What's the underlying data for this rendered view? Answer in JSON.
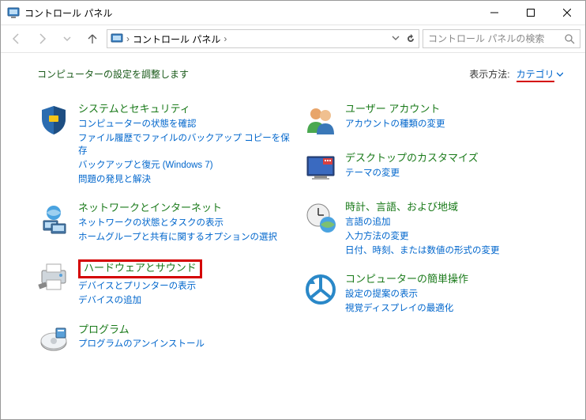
{
  "window": {
    "title": "コントロール パネル"
  },
  "address": {
    "root": "コントロール パネル"
  },
  "search": {
    "placeholder": "コントロール パネルの検索"
  },
  "header": {
    "heading": "コンピューターの設定を調整します",
    "viewLabel": "表示方法:",
    "viewValue": "カテゴリ"
  },
  "left": [
    {
      "title": "システムとセキュリティ",
      "links": [
        "コンピューターの状態を確認",
        "ファイル履歴でファイルのバックアップ コピーを保存",
        "バックアップと復元 (Windows 7)",
        "問題の発見と解決"
      ]
    },
    {
      "title": "ネットワークとインターネット",
      "links": [
        "ネットワークの状態とタスクの表示",
        "ホームグループと共有に関するオプションの選択"
      ]
    },
    {
      "title": "ハードウェアとサウンド",
      "links": [
        "デバイスとプリンターの表示",
        "デバイスの追加"
      ],
      "highlight": true
    },
    {
      "title": "プログラム",
      "links": [
        "プログラムのアンインストール"
      ]
    }
  ],
  "right": [
    {
      "title": "ユーザー アカウント",
      "links": [
        "アカウントの種類の変更"
      ]
    },
    {
      "title": "デスクトップのカスタマイズ",
      "links": [
        "テーマの変更"
      ]
    },
    {
      "title": "時計、言語、および地域",
      "links": [
        "言語の追加",
        "入力方法の変更",
        "日付、時刻、または数値の形式の変更"
      ]
    },
    {
      "title": "コンピューターの簡単操作",
      "links": [
        "設定の提案の表示",
        "視覚ディスプレイの最適化"
      ]
    }
  ]
}
